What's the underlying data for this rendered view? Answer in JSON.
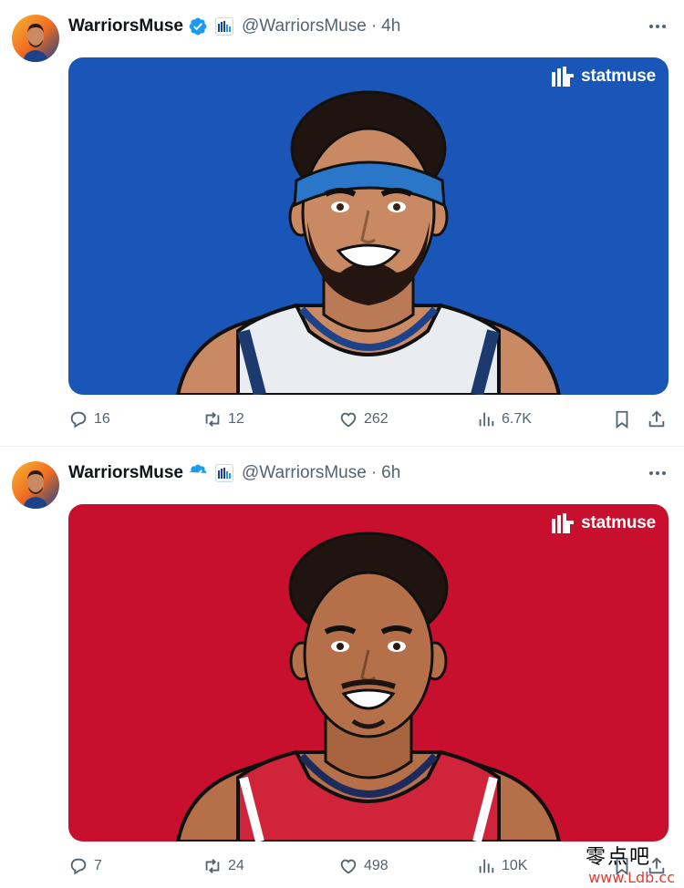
{
  "tweets": [
    {
      "display_name": "WarriorsMuse",
      "handle": "@WarriorsMuse",
      "separator": "·",
      "time": "4h",
      "media": {
        "brand": "statmuse",
        "background": "#1a55b8"
      },
      "stats": {
        "replies": "16",
        "retweets": "12",
        "likes": "262",
        "views": "6.7K"
      }
    },
    {
      "display_name": "WarriorsMuse",
      "handle": "@WarriorsMuse",
      "separator": "·",
      "time": "6h",
      "media": {
        "brand": "statmuse",
        "background": "#c8102e"
      },
      "stats": {
        "replies": "7",
        "retweets": "24",
        "likes": "498",
        "views": "10K"
      }
    }
  ],
  "icons": [
    "verified-badge-icon",
    "affiliate-badge-icon",
    "more-icon",
    "reply-icon",
    "retweet-icon",
    "like-icon",
    "views-icon",
    "bookmark-icon",
    "share-icon"
  ],
  "colors": {
    "verified": "#1d9bf0",
    "text_secondary": "#536471",
    "blue_card": "#1a55b8",
    "red_card": "#c8102e"
  },
  "watermark": {
    "chinese": "零点吧",
    "url": "www.Ldb.cc"
  }
}
